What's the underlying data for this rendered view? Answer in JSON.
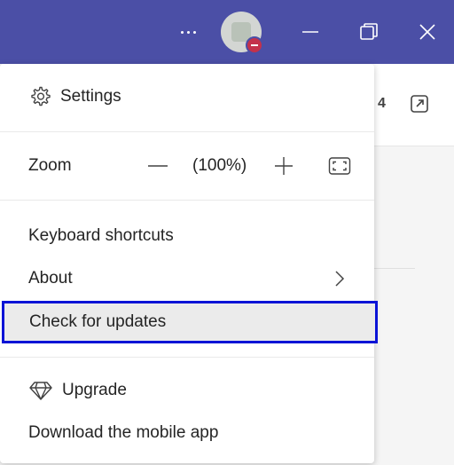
{
  "menu": {
    "settings_label": "Settings",
    "zoom": {
      "label": "Zoom",
      "level": "(100%)"
    },
    "keyboard_shortcuts_label": "Keyboard shortcuts",
    "about_label": "About",
    "check_updates_label": "Check for updates",
    "upgrade_label": "Upgrade",
    "download_mobile_label": "Download the mobile app"
  },
  "background": {
    "count_text": "4"
  },
  "icons": {
    "titlebar": [
      "more-options-icon",
      "avatar",
      "minimize-icon",
      "restore-icon",
      "close-icon"
    ],
    "menu": [
      "gear-icon",
      "minus-icon",
      "plus-icon",
      "fullscreen-icon",
      "chevron-right-icon",
      "diamond-icon"
    ]
  },
  "colors": {
    "titlebar": "#4b4fa6",
    "presence_busy": "#c4314b",
    "highlight_border": "#0a13d6"
  }
}
